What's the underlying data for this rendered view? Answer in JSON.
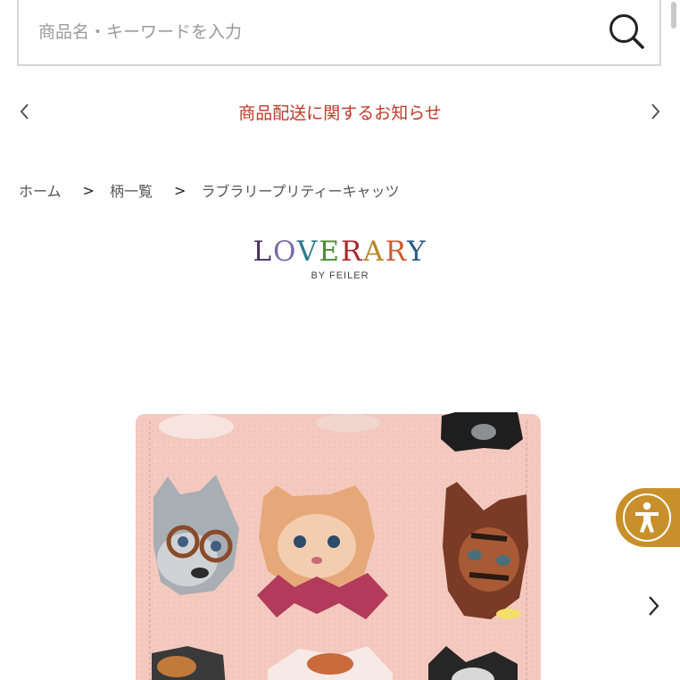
{
  "search": {
    "placeholder": "商品名・キーワードを入力",
    "icon": "search-icon"
  },
  "notice": {
    "text": "商品配送に関するお知らせ",
    "text_color": "#c0392b"
  },
  "breadcrumb": {
    "separator": ">",
    "items": [
      "ホーム",
      "柄一覧",
      "ラブラリープリティーキャッツ"
    ]
  },
  "brand": {
    "letters": [
      {
        "char": "L",
        "color": "#4a2f5e"
      },
      {
        "char": "O",
        "color": "#7a6aa8"
      },
      {
        "char": "V",
        "color": "#2e7a8c"
      },
      {
        "char": "E",
        "color": "#4f8b3a"
      },
      {
        "char": "R",
        "color": "#a8262e"
      },
      {
        "char": "A",
        "color": "#b8862c"
      },
      {
        "char": "R",
        "color": "#d05a2a"
      },
      {
        "char": "Y",
        "color": "#2b5a8a"
      }
    ],
    "sub": "BY FEILER"
  },
  "product": {
    "image": "cat-towel-handkerchief-image"
  },
  "accessibility": {
    "icon": "accessibility-icon",
    "color": "#c8902a"
  }
}
